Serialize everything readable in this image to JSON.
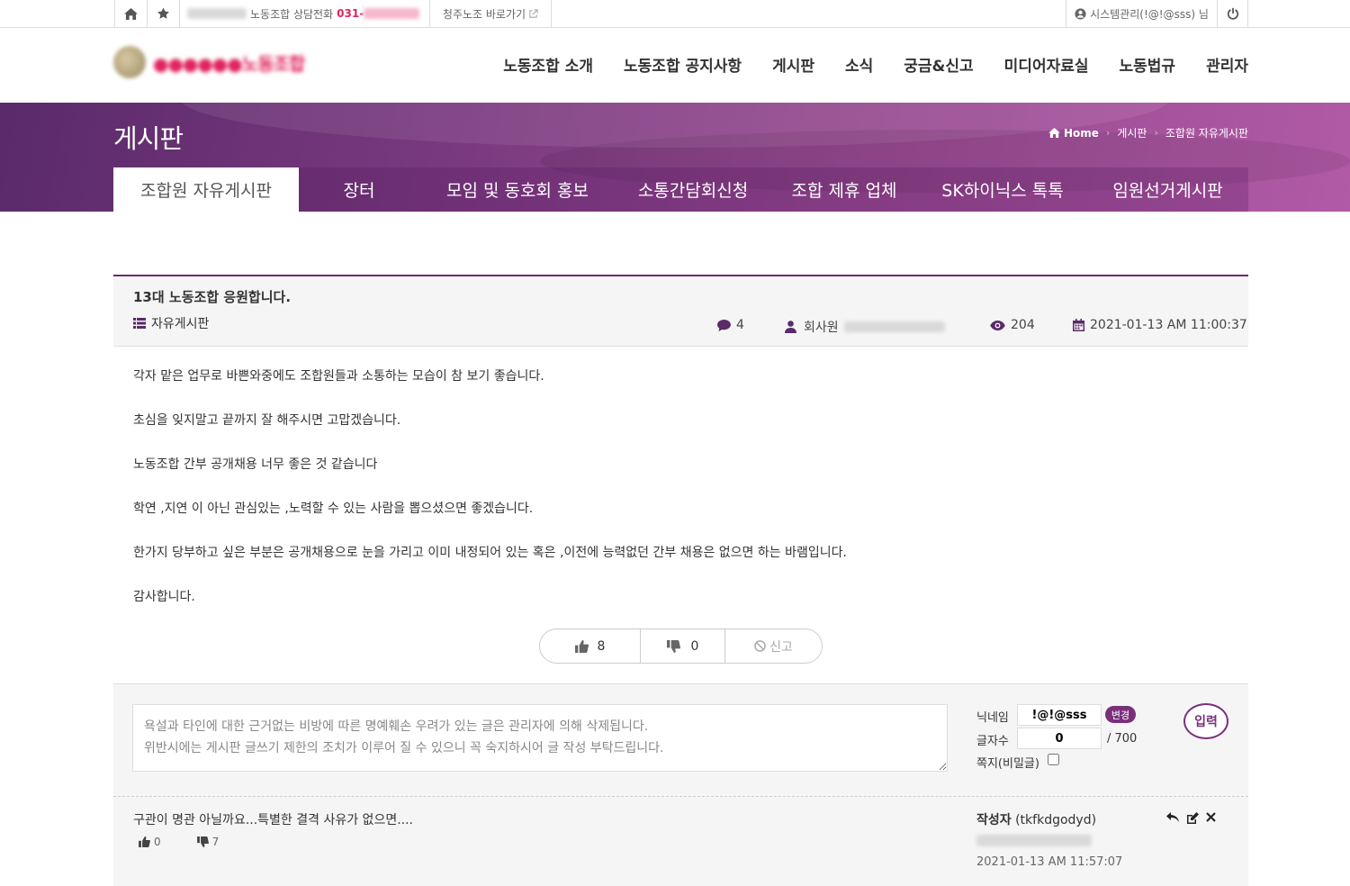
{
  "topbar": {
    "phone_label": "노동조합 상담전화",
    "phone_number": "031-",
    "link_label": "청주노조 바로가기",
    "user_label": "시스템관리(!@!@sss) 님"
  },
  "header": {
    "nav": [
      "노동조합 소개",
      "노동조합 공지사항",
      "게시판",
      "소식",
      "궁금&신고",
      "미디어자료실",
      "노동법규",
      "관리자"
    ]
  },
  "banner": {
    "title": "게시판",
    "breadcrumb": {
      "home": "Home",
      "level1": "게시판",
      "level2": "조합원 자유게시판"
    },
    "tabs": [
      "조합원 자유게시판",
      "장터",
      "모임 및 동호회 홍보",
      "소통간담회신청",
      "조합 제휴 업체",
      "SK하이닉스 톡톡",
      "임원선거게시판"
    ]
  },
  "post": {
    "title": "13대 노동조합 응원합니다.",
    "category": "자유게시판",
    "comment_count": "4",
    "author": "회사원",
    "views": "204",
    "date": "2021-01-13 AM 11:00:37",
    "body": [
      "각자 맡은 업무로 바쁜와중에도 조합원들과 소통하는 모습이 참 보기 좋습니다.",
      "초심을 잊지말고 끝까지 잘 해주시면 고맙겠습니다.",
      "노동조합 간부 공개채용 너무 좋은 것 같습니다",
      "학연 ,지연 이 아닌 관심있는 ,노력할 수 있는 사람을 뽑으셨으면 좋겠습니다.",
      "한가지 당부하고 싶은 부분은 공개채용으로 눈을 가리고 이미 내정되어 있는 혹은 ,이전에 능력없던 간부 채용은 없으면 하는 바램입니다.",
      "감사합니다."
    ],
    "likes": "8",
    "dislikes": "0",
    "report_label": "신고"
  },
  "comment_form": {
    "placeholder": "욕설과 타인에 대한 근거없는 비방에 따른 명예훼손 우려가 있는 글은 관리자에 의해 삭제됩니다.\n위반시에는 게시판 글쓰기 제한의 조치가 이루어 질 수 있으니 꼭 숙지하시어 글 작성 부탁드립니다.",
    "nickname_label": "닉네임",
    "nickname_value": "!@!@sss",
    "change_label": "변경",
    "count_label": "글자수",
    "count_value": "0",
    "count_max": "/ 700",
    "secret_label": "쪽지(비밀글)",
    "submit_label": "입력"
  },
  "comments": [
    {
      "text": "구관이 명관 아닐까요...특별한 결격 사유가 없으면....",
      "likes": "0",
      "dislikes": "7",
      "author_label": "작성자",
      "author_id": "(tkfkdgodyd)",
      "date": "2021-01-13 AM 11:57:07"
    }
  ],
  "colors": {
    "brand": "#7a2f7a",
    "banner_start": "#5a2a6a",
    "banner_end": "#b15aa5",
    "phone": "#e0245e"
  }
}
